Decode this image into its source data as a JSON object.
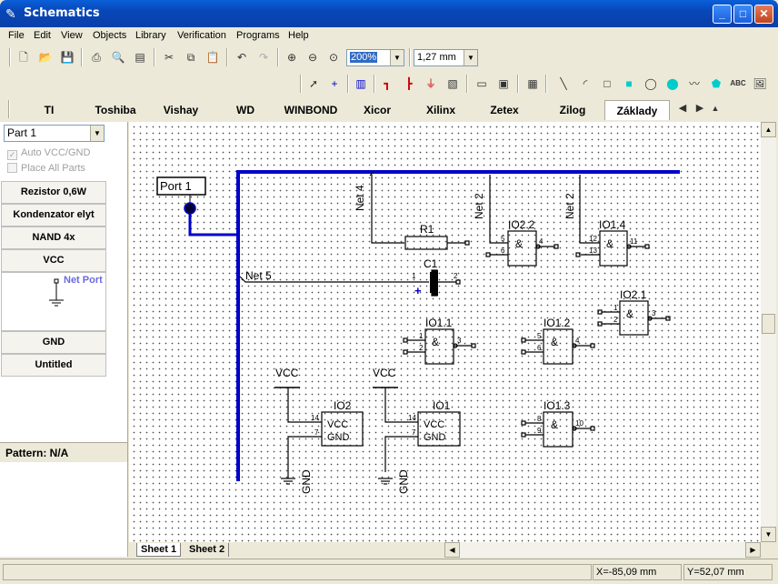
{
  "window": {
    "title": "Schematics"
  },
  "menu": [
    "File",
    "Edit",
    "View",
    "Objects",
    "Library",
    "Verification",
    "Programs",
    "Help"
  ],
  "toolbar": {
    "zoom_value": "200%",
    "grid_value": "1,27 mm"
  },
  "library_tabs": [
    "TI",
    "Toshiba",
    "Vishay",
    "WD",
    "WINBOND",
    "Xicor",
    "Xilinx",
    "Zetex",
    "Zilog",
    "Základy"
  ],
  "left_panel": {
    "part_select": "Part 1",
    "auto_vcc": "Auto VCC/GND",
    "place_all": "Place All Parts",
    "parts": [
      "Rezistor 0,6W",
      "Kondenzator elyt",
      "NAND 4x",
      "VCC",
      "GND",
      "Untitled"
    ],
    "net_port_label": "Net Port",
    "pattern": "Pattern: N/A"
  },
  "schematic": {
    "port_label": "Port  1",
    "net4": "Net 4",
    "net2a": "Net  2",
    "net2b": "Net  2",
    "net5": "Net  5",
    "r1": "R1",
    "c1": "C1",
    "io22": "IO2.2",
    "io14": "IO1.4",
    "io21": "IO2.1",
    "io11": "IO1.1",
    "io12": "IO1.2",
    "io13": "IO1.3",
    "io2": "IO2",
    "io1": "IO1",
    "vcc": "VCC",
    "gnd": "GND",
    "and_sym": "&",
    "p1": "1",
    "p2": "2",
    "p3": "3",
    "p4": "4",
    "p5": "5",
    "p6": "6",
    "p7": "7",
    "p8": "8",
    "p9": "9",
    "p10": "10",
    "p11": "11",
    "p12": "12",
    "p13": "13",
    "p14": "14"
  },
  "sheets": [
    "Sheet 1",
    "Sheet 2"
  ],
  "status": {
    "x": "X=-85,09 mm",
    "y": "Y=52,07 mm"
  },
  "colors": {
    "wire": "#0000cc",
    "titlebar": "#0a4fc8"
  }
}
